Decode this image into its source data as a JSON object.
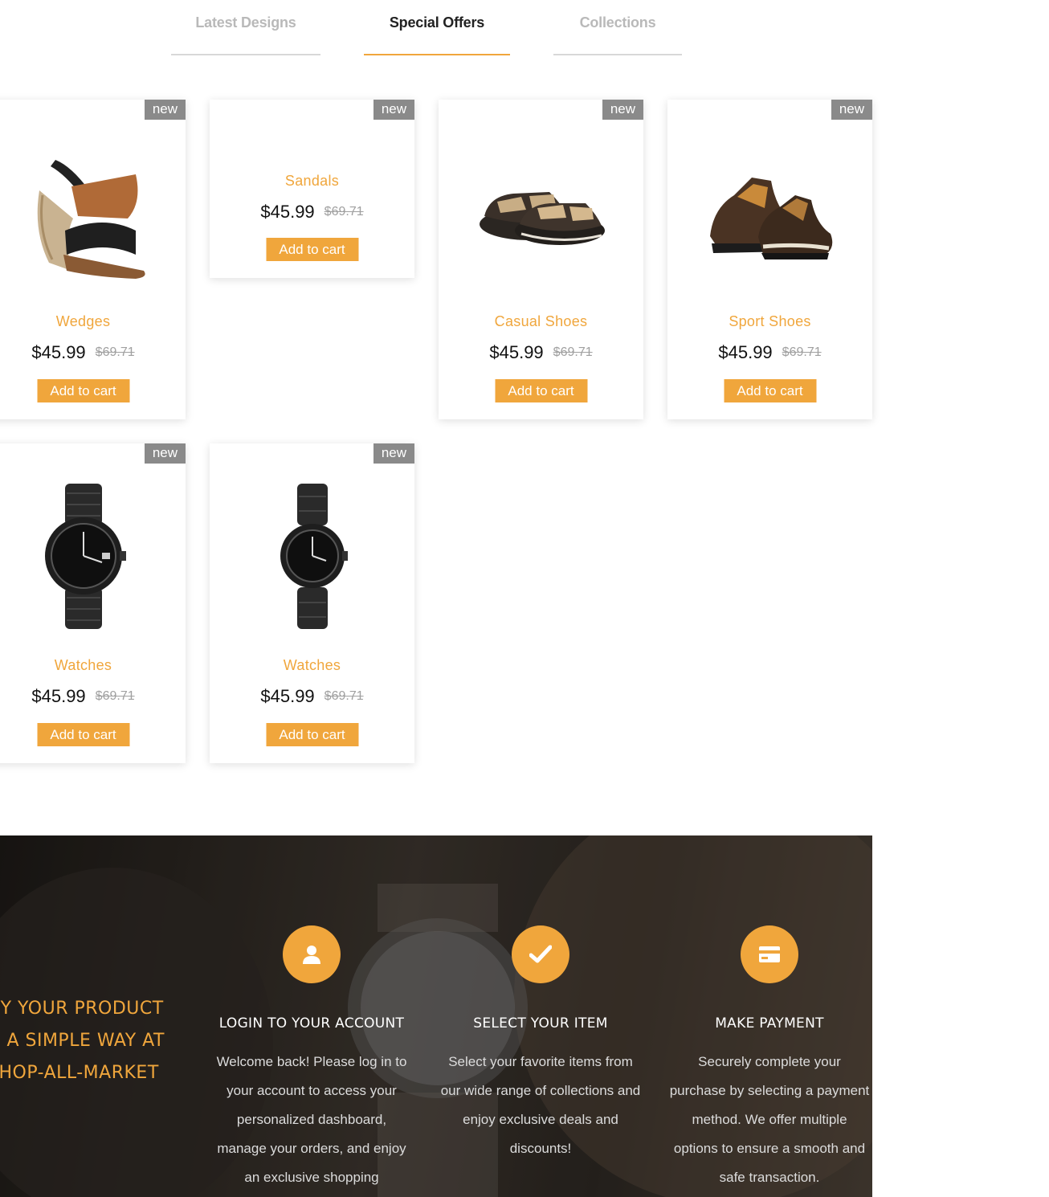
{
  "tabs": [
    {
      "label": "Latest Designs",
      "active": false
    },
    {
      "label": "Special Offers",
      "active": true
    },
    {
      "label": "Collections",
      "active": false
    }
  ],
  "products": [
    {
      "badge": "new",
      "name": "Wedges",
      "price": "$45.99",
      "old_price": "$69.71",
      "cta": "Add to cart",
      "image": "wedge-sandal-image"
    },
    {
      "badge": "new",
      "name": "Sandals",
      "price": "$45.99",
      "old_price": "$69.71",
      "cta": "Add to cart",
      "image": ""
    },
    {
      "badge": "new",
      "name": "Casual Shoes",
      "price": "$45.99",
      "old_price": "$69.71",
      "cta": "Add to cart",
      "image": "casual-sandal-image"
    },
    {
      "badge": "new",
      "name": "Sport Shoes",
      "price": "$45.99",
      "old_price": "$69.71",
      "cta": "Add to cart",
      "image": "sport-shoe-image"
    },
    {
      "badge": "new",
      "name": "Watches",
      "price": "$45.99",
      "old_price": "$69.71",
      "cta": "Add to cart",
      "image": "watch-image"
    },
    {
      "badge": "new",
      "name": "Watches",
      "price": "$45.99",
      "old_price": "$69.71",
      "cta": "Add to cart",
      "image": "watch-image"
    }
  ],
  "banner": {
    "title_lines": [
      "UY YOUR PRODUCT",
      "N A SIMPLE WAY AT",
      "SHOP-ALL-MARKET"
    ],
    "steps": [
      {
        "icon": "user-icon",
        "title": "LOGIN TO YOUR ACCOUNT",
        "text": "Welcome back! Please log in to your account to access your personalized dashboard, manage your orders, and enjoy an exclusive shopping"
      },
      {
        "icon": "check-icon",
        "title": "SELECT YOUR ITEM",
        "text": "Select your favorite items from our wide range of collections and enjoy exclusive deals and discounts!"
      },
      {
        "icon": "credit-card-icon",
        "title": "MAKE PAYMENT",
        "text": "Securely complete your purchase by selecting a payment method. We offer multiple options to ensure a smooth and safe transaction."
      }
    ]
  },
  "colors": {
    "accent": "#f0a63c",
    "badge": "#8a8a8a",
    "price": "#111111",
    "old_price": "#a0a0a0"
  }
}
